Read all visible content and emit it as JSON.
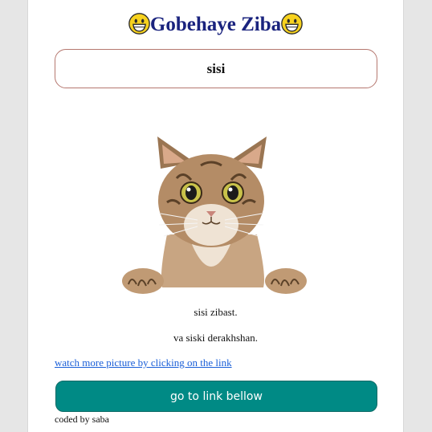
{
  "header": {
    "title": "Gobehaye Ziba",
    "left_icon": "grinning-face-emoji",
    "right_icon": "grinning-face-emoji",
    "title_color": "#1a237e"
  },
  "name_box": {
    "value": "sisi"
  },
  "image": {
    "subject": "cat-photo"
  },
  "text": {
    "line1": "sisi zibast.",
    "line2": "va siski derakhshan."
  },
  "link": {
    "label": "watch more picture by clicking on the link"
  },
  "button": {
    "label": "go to link bellow",
    "color": "#008a85"
  },
  "footer": {
    "text": "coded by saba"
  }
}
